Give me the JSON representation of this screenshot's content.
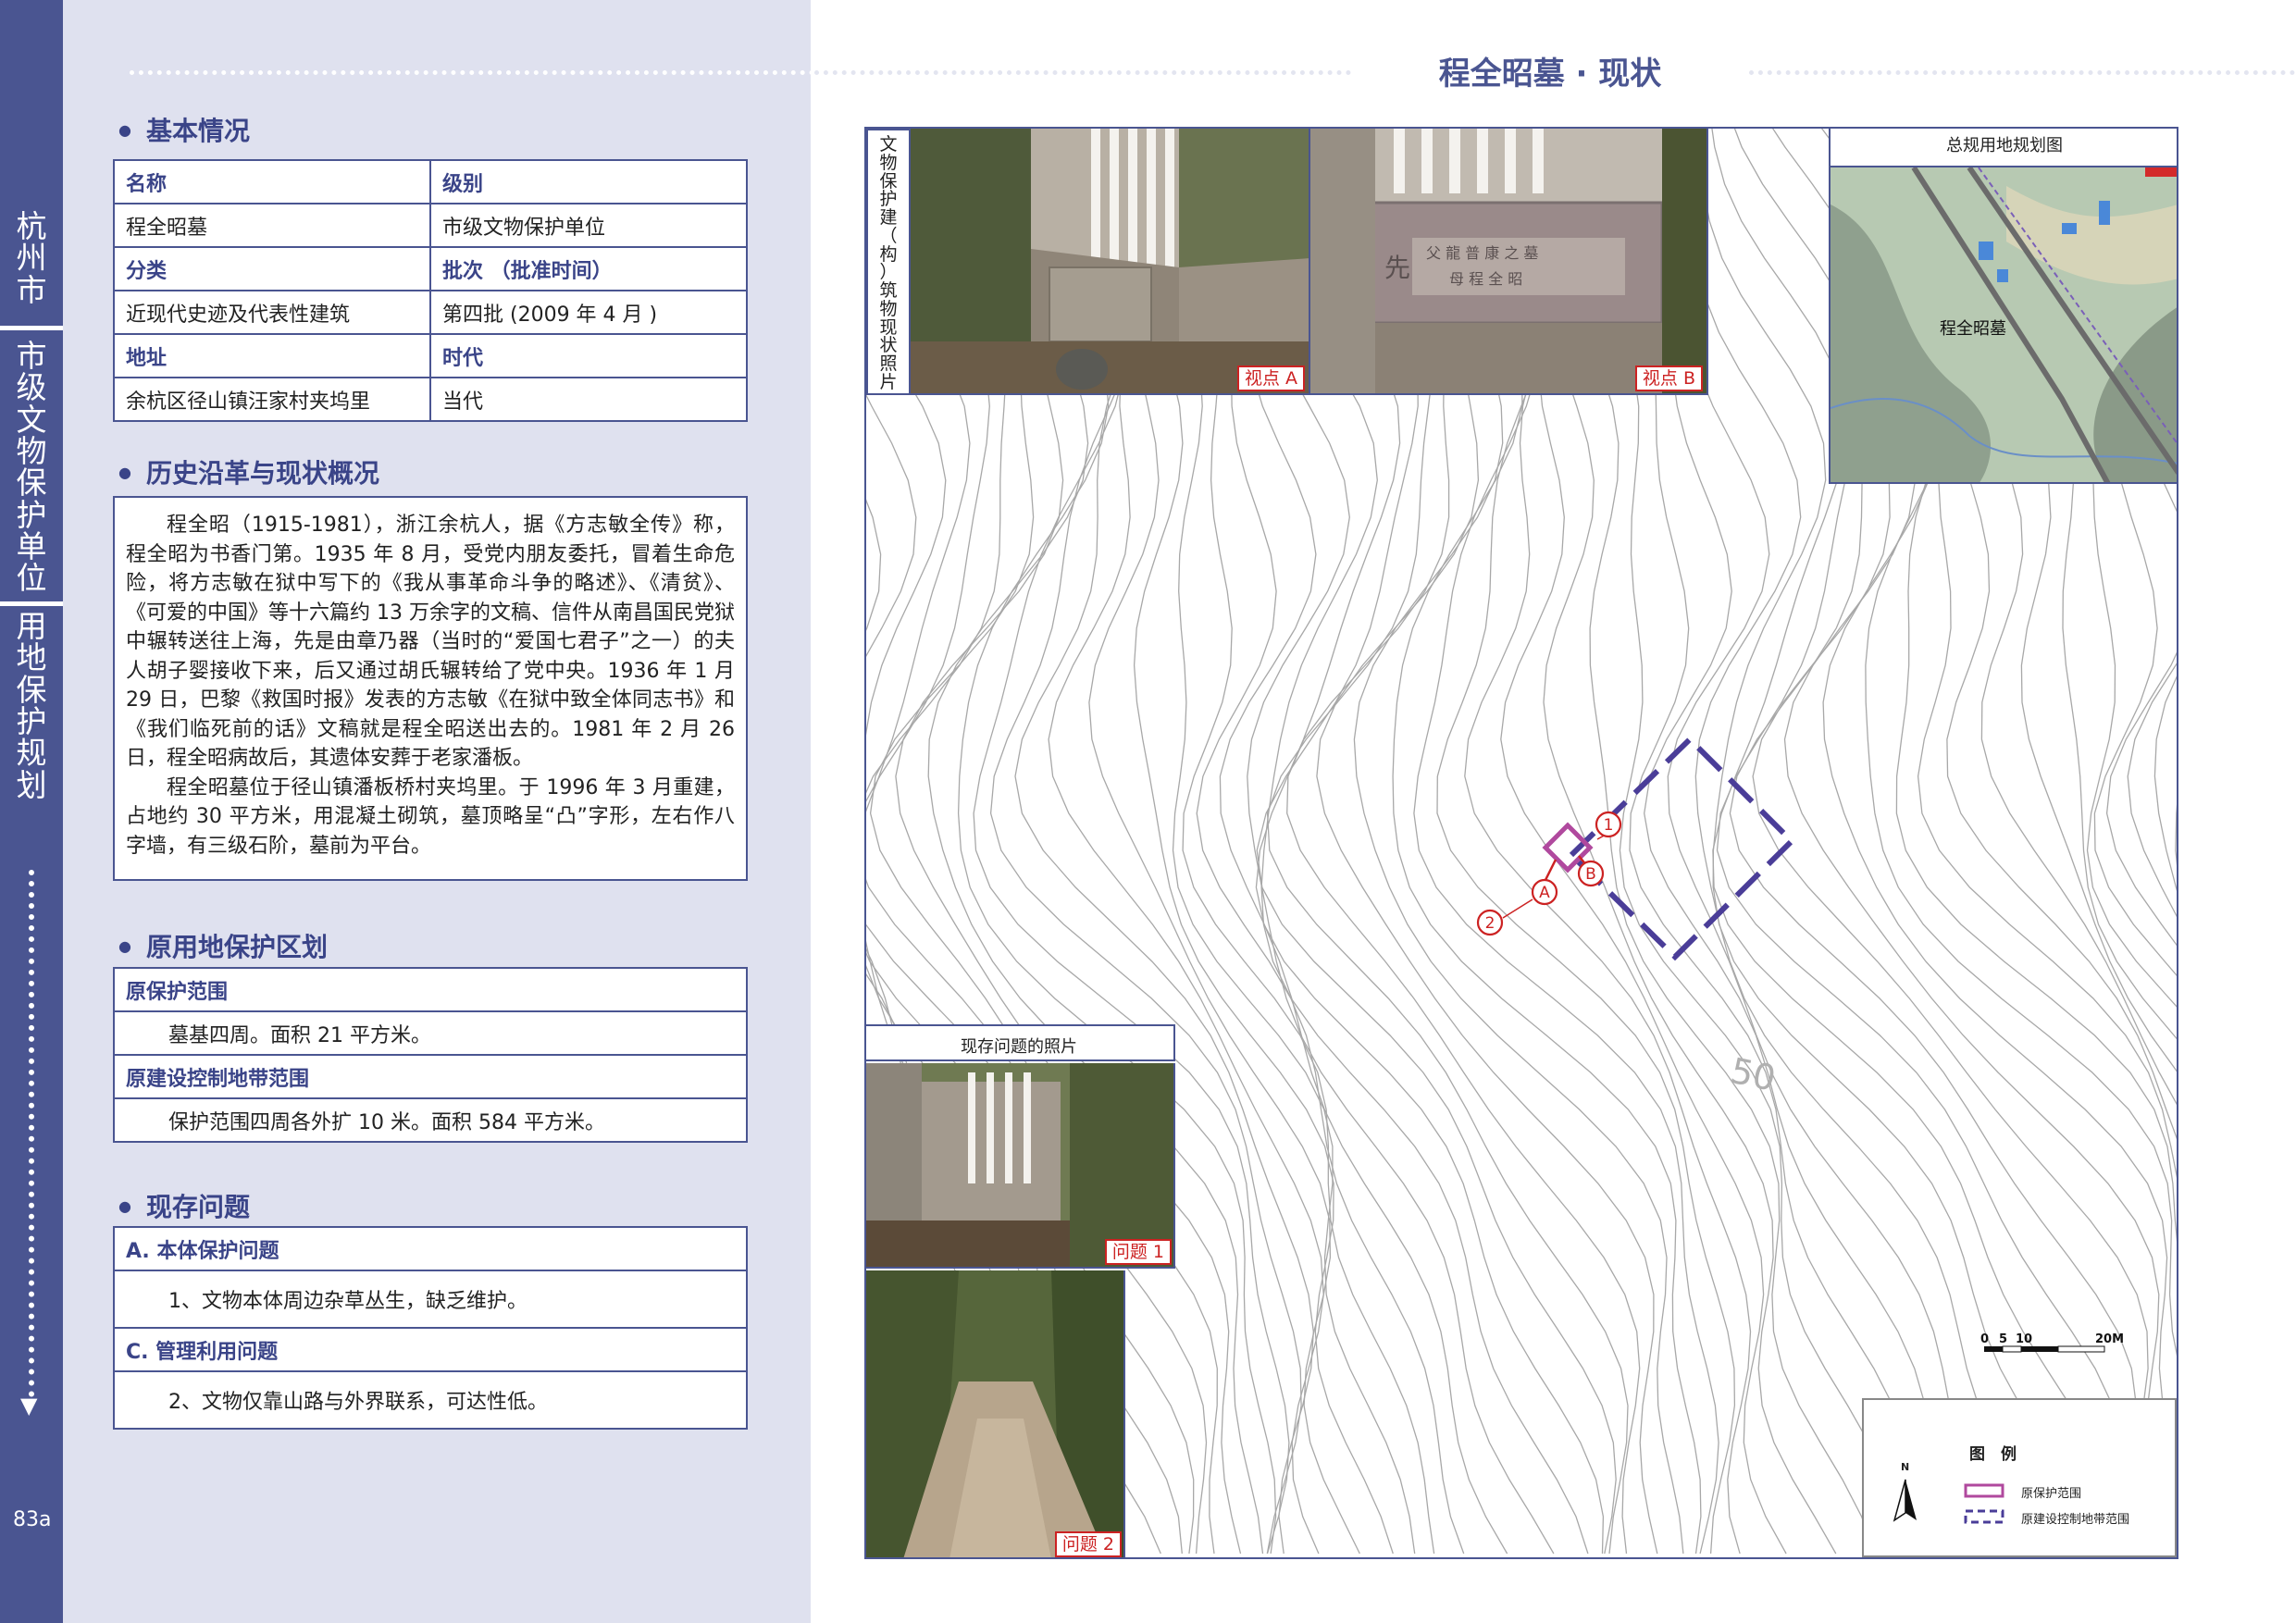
{
  "sidebar": {
    "title1_chars": [
      "杭",
      "州",
      "市"
    ],
    "title2_chars": [
      "市",
      "级",
      "文",
      "物",
      "保",
      "护",
      "单",
      "位"
    ],
    "title3_chars": [
      "用",
      "地",
      "保",
      "护",
      "规",
      "划"
    ],
    "page_number": "83a"
  },
  "basic": {
    "title": "基本情况",
    "rows": [
      [
        "名称",
        "级别"
      ],
      [
        "程全昭墓",
        "市级文物保护单位"
      ],
      [
        "分类",
        "批次 （批准时间）"
      ],
      [
        "近现代史迹及代表性建筑",
        "第四批 (2009 年 4 月 )"
      ],
      [
        "地址",
        "时代"
      ],
      [
        "余杭区径山镇汪家村夹坞里",
        "当代"
      ]
    ]
  },
  "history": {
    "title": "历史沿革与现状概况",
    "paragraphs": [
      "程全昭（1915-1981），浙江余杭人，据《方志敏全传》称，程全昭为书香门第。1935 年 8 月，受党内朋友委托，冒着生命危险，将方志敏在狱中写下的《我从事革命斗争的略述》、《清贫》、《可爱的中国》等十六篇约 13 万余字的文稿、信件从南昌国民党狱中辗转送往上海，先是由章乃器（当时的“爱国七君子”之一）的夫人胡子婴接收下来，后又通过胡氏辗转给了党中央。1936 年 1 月 29 日，巴黎《救国时报》发表的方志敏《在狱中致全体同志书》和《我们临死前的话》文稿就是程全昭送出去的。1981 年 2 月 26 日，程全昭病故后，其遗体安葬于老家潘板。",
      "程全昭墓位于径山镇潘板桥村夹坞里。于 1996 年 3 月重建，占地约 30 平方米，用混凝土砌筑，墓顶略呈“凸”字形，左右作八字墙，有三级石阶，墓前为平台。"
    ]
  },
  "protection": {
    "title": "原用地保护区划",
    "range_header": "原保护范围",
    "range_text": "墓基四周。面积 21 平方米。",
    "control_header": "原建设控制地带范围",
    "control_text": "保护范围四周各外扩 10 米。面积 584 平方米。"
  },
  "issues": {
    "title": "现存问题",
    "a_header": "A. 本体保护问题",
    "a_text": "1、文物本体周边杂草丛生，缺乏维护。",
    "c_header": "C. 管理利用问题",
    "c_text": "2、文物仅靠山路与外界联系，可达性低。"
  },
  "right": {
    "page_title": "程全昭墓 · 现状",
    "photo_caption_chars": [
      "文",
      "物",
      "保",
      "护",
      "建",
      "（",
      "构",
      "）",
      "筑",
      "物",
      "现",
      "状",
      "照",
      "片"
    ],
    "view_a": "视点 A",
    "view_b": "视点 B",
    "overview_title": "总规用地规划图",
    "overview_label": "程全昭墓",
    "issues_photo_title": "现存问题的照片",
    "issue1": "问题 1",
    "issue2": "问题 2",
    "contour_label": "50",
    "marker_1": "1",
    "marker_2": "2",
    "marker_a": "A",
    "marker_b": "B",
    "scale_ticks": [
      "0",
      "5",
      "10",
      "20M"
    ],
    "legend_title": "图　例",
    "legend_north": "N",
    "legend_item1": "原保护范围",
    "legend_item2": "原建设控制地带范围"
  },
  "colors": {
    "brand": "#4a5591",
    "left_bg": "#dfe1ef",
    "marker_red": "#cc2222",
    "protection_pink": "#b0499e",
    "control_purple": "#4a3d98"
  }
}
